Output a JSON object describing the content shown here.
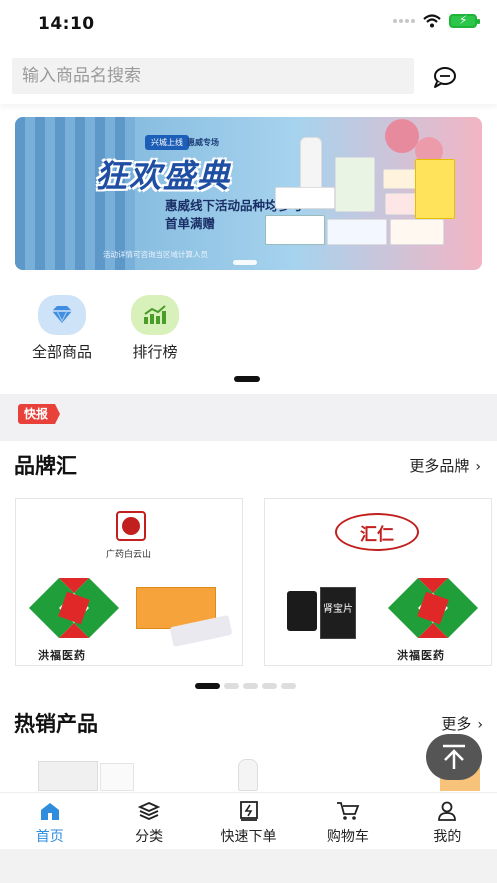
{
  "status": {
    "time": "14:10"
  },
  "search": {
    "placeholder": "输入商品名搜索"
  },
  "banner": {
    "tag": "兴城上线",
    "tag2": "惠威专场",
    "title": "狂欢盛典",
    "subtitle": "惠威线下活动品种均参与首单满赠",
    "note": "活动详情可咨询当区域计算人员"
  },
  "categories": [
    {
      "label": "全部商品",
      "icon": "diamond-icon",
      "bg": "#cfe3f8",
      "color": "#3f8ee0"
    },
    {
      "label": "排行榜",
      "icon": "trend-chart-icon",
      "bg": "#d8f0b9",
      "color": "#4a9d2a"
    }
  ],
  "news": {
    "badge": "快报"
  },
  "brands": {
    "title": "品牌汇",
    "more": "更多品牌",
    "cards": [
      {
        "logo_text": "广药白云山",
        "partner": "洪福医药"
      },
      {
        "logo_text": "汇仁",
        "product": "肾宝片",
        "partner": "洪福医药"
      }
    ],
    "dots": 5
  },
  "hot": {
    "title": "热销产品",
    "more": "更多"
  },
  "tabbar": [
    {
      "label": "首页",
      "icon": "home-icon",
      "active": true
    },
    {
      "label": "分类",
      "icon": "layers-icon",
      "active": false
    },
    {
      "label": "快速下单",
      "icon": "quick-order-icon",
      "active": false
    },
    {
      "label": "购物车",
      "icon": "cart-icon",
      "active": false
    },
    {
      "label": "我的",
      "icon": "user-icon",
      "active": false
    }
  ],
  "colors": {
    "accent": "#2f8dde",
    "badge_red": "#e8413a"
  }
}
